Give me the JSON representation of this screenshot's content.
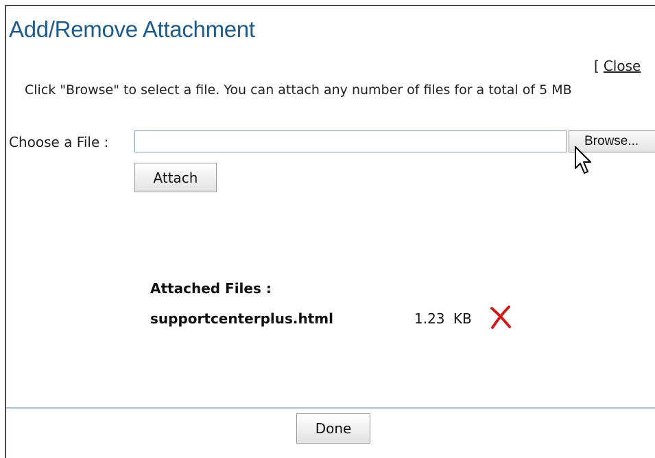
{
  "dialog": {
    "title": "Add/Remove Attachment",
    "close_bracket": "[",
    "close_label": "Close",
    "instruction": "Click \"Browse\" to select a file. You can attach any number of files for a total of 5 MB"
  },
  "upload": {
    "choose_label": "Choose a File :",
    "file_value": "",
    "browse_label": "Browse...",
    "attach_label": "Attach"
  },
  "attached": {
    "heading": "Attached Files :",
    "files": [
      {
        "name": "supportcenterplus.html",
        "size": "1.23 KB",
        "remove_icon": "red-x-delete-icon"
      }
    ]
  },
  "footer": {
    "done_label": "Done"
  },
  "colors": {
    "title": "#1f5c8a",
    "remove_icon": "#d11a1a",
    "divider": "#a9c1d6",
    "input_border": "#7f9db9"
  }
}
